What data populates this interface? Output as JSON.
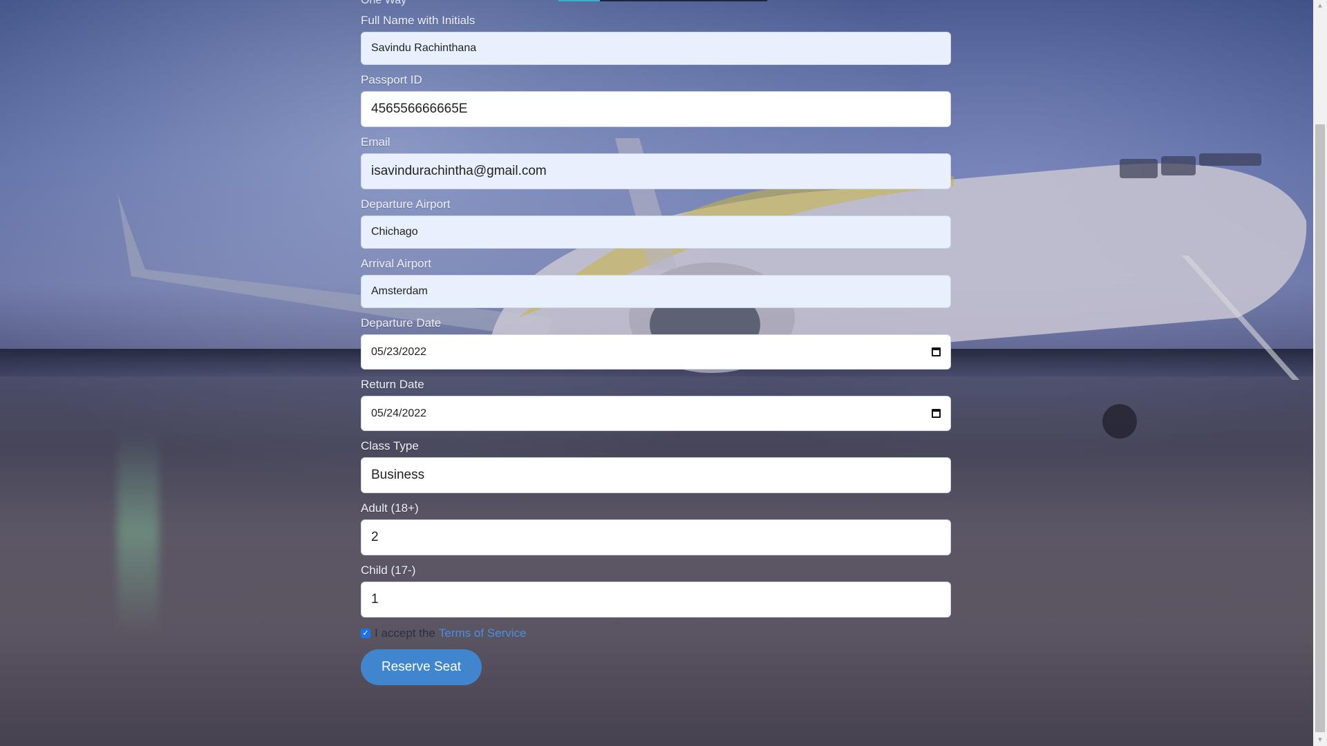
{
  "top_partial_text": "One Way",
  "form": {
    "full_name": {
      "label": "Full Name with Initials",
      "value": "Savindu Rachinthana"
    },
    "passport": {
      "label": "Passport ID",
      "value": "456556666665E"
    },
    "email": {
      "label": "Email",
      "value": "isavindurachintha@gmail.com"
    },
    "departure_airport": {
      "label": "Departure Airport",
      "value": "Chichago"
    },
    "arrival_airport": {
      "label": "Arrival Airport",
      "value": "Amsterdam"
    },
    "departure_date": {
      "label": "Departure Date",
      "value": "05/23/2022",
      "icon": "calendar-icon"
    },
    "return_date": {
      "label": "Return Date",
      "value": "05/24/2022",
      "icon": "calendar-icon"
    },
    "class_type": {
      "label": "Class Type",
      "value": "Business"
    },
    "adult": {
      "label": "Adult (18+)",
      "value": "2"
    },
    "child": {
      "label": "Child (17-)",
      "value": "1"
    },
    "terms": {
      "checked": true,
      "prefix": "I accept the",
      "link_text": "Terms of Service"
    },
    "submit_label": "Reserve Seat"
  },
  "colors": {
    "autofill_bg": "#e8f0fe",
    "button_bg": "#3f86cf",
    "link": "#4a8fe0"
  }
}
